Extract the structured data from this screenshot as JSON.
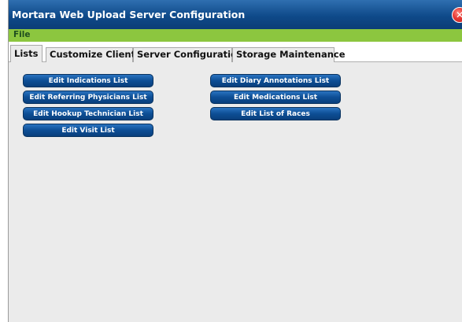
{
  "window": {
    "title": "Mortara Web Upload Server Configuration"
  },
  "icons": {
    "close": "close-x-icon"
  },
  "menu": {
    "file": "File"
  },
  "tabs": [
    {
      "label": "Lists",
      "active": true
    },
    {
      "label": "Customize Client",
      "active": false
    },
    {
      "label": "Server Configuration",
      "active": false
    },
    {
      "label": "Storage Maintenance",
      "active": false
    }
  ],
  "buttons": {
    "left": [
      "Edit Indications List",
      "Edit Referring Physicians List",
      "Edit Hookup Technician List",
      "Edit Visit List"
    ],
    "right": [
      "Edit Diary Annotations List",
      "Edit Medications List",
      "Edit List of Races"
    ]
  },
  "colors": {
    "titlebar": "#0f4a8a",
    "menubar": "#8cc63f",
    "button": "#0d4e95",
    "close": "#e53935"
  }
}
